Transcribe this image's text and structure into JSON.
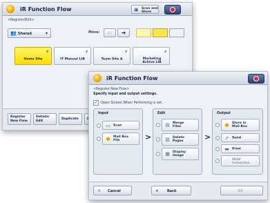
{
  "back_window": {
    "title": "iR Function Flow",
    "breadcrumb": "<Register/Edit>",
    "scan_store_label": "Scan and Store",
    "filter_select": "Shared",
    "move_label": "Move:",
    "flows": [
      "Home Site",
      "IT Manual LIB",
      "Team Site A",
      "Marketing Achive LIB"
    ],
    "selected_flow": "Home Site",
    "bottom_buttons": [
      "Register New Flow",
      "Details/ Edit",
      "Duplicate",
      "Delete"
    ]
  },
  "front_window": {
    "title": "iR Function Flow",
    "heading": "<Register New Flow>",
    "instruction": "Specify input and output settings.",
    "checkbox_label": "Open Screen When Performing is set.",
    "columns": {
      "input": {
        "label": "Input",
        "items": [
          {
            "label": "Scan",
            "icon": "scanner-icon"
          },
          {
            "label": "Mail Box File",
            "icon": "mailbox-icon"
          }
        ]
      },
      "edit": {
        "label": "Edit",
        "items": [
          {
            "label": "Merge Files",
            "icon": "merge-icon"
          },
          {
            "label": "Delete Pages",
            "icon": "delete-pages-icon"
          },
          {
            "label": "Display Image",
            "icon": "display-icon"
          }
        ]
      },
      "output": {
        "label": "Output",
        "items": [
          {
            "label": "Store in Mail Box",
            "icon": "store-icon"
          },
          {
            "label": "Send",
            "icon": "send-icon"
          },
          {
            "label": "Print",
            "icon": "print-icon"
          },
          {
            "label": "MEAP Connection",
            "icon": "meap-icon"
          }
        ]
      }
    },
    "bottom": {
      "cancel": "Cancel",
      "back": "Back",
      "next": "OK"
    }
  }
}
